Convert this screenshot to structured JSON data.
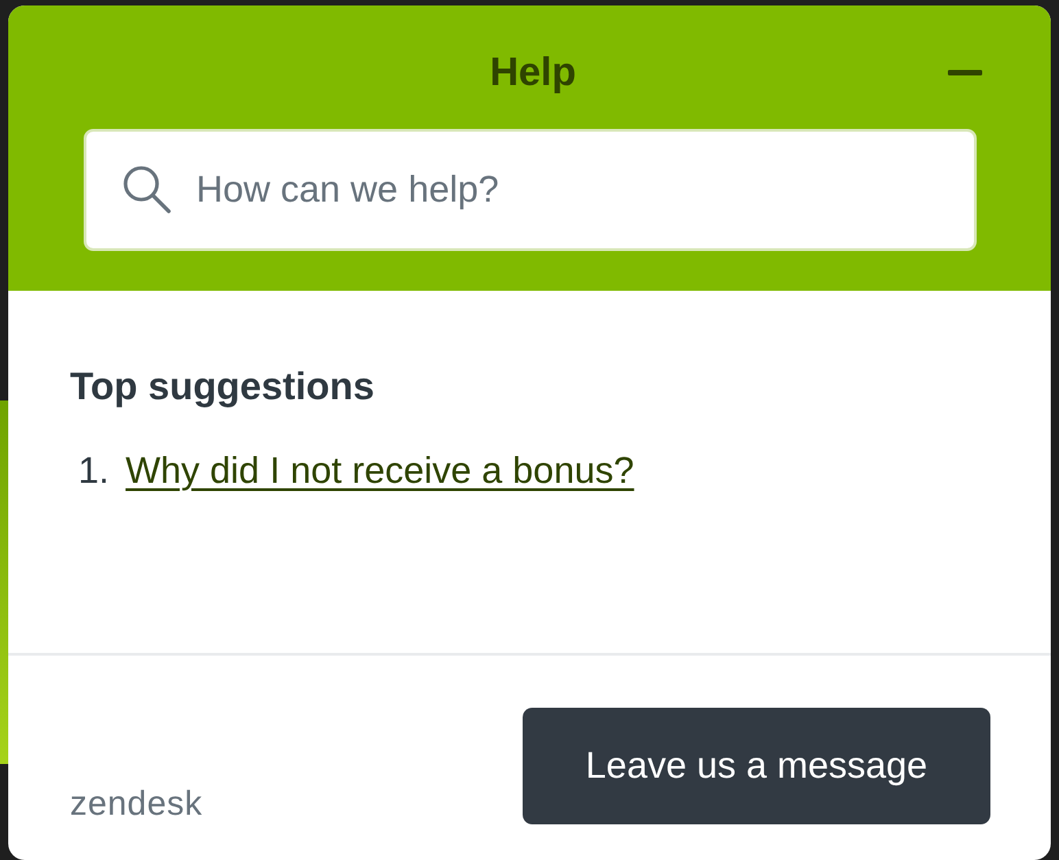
{
  "header": {
    "title": "Help",
    "search": {
      "placeholder": "How can we help?"
    }
  },
  "suggestions": {
    "heading": "Top suggestions",
    "items": [
      {
        "number": "1.",
        "title": "Why did I not receive a bonus?"
      }
    ]
  },
  "footer": {
    "brand": "zendesk",
    "button": "Leave us a message"
  }
}
